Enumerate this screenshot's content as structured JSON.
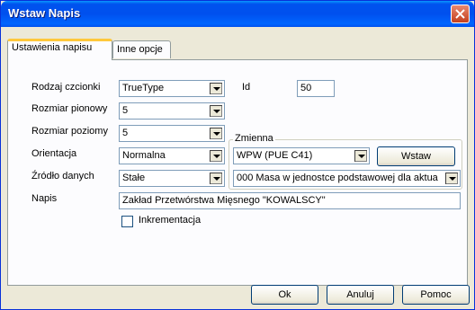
{
  "window": {
    "title": "Wstaw Napis"
  },
  "tabs": [
    {
      "label": "Ustawienia napisu",
      "active": true
    },
    {
      "label": "Inne opcje",
      "active": false
    }
  ],
  "fields": {
    "font_type": {
      "label": "Rodzaj czcionki",
      "value": "TrueType"
    },
    "id": {
      "label": "Id",
      "value": "50"
    },
    "vertical_size": {
      "label": "Rozmiar pionowy",
      "value": "5"
    },
    "horizontal_size": {
      "label": "Rozmiar poziomy",
      "value": "5"
    },
    "orientation": {
      "label": "Orientacja",
      "value": "Normalna"
    },
    "data_source": {
      "label": "Źródło danych",
      "value": "Stałe"
    },
    "text": {
      "label": "Napis",
      "value": "Zakład Przetwórstwa Mięsnego \"KOWALSCY\""
    },
    "increment": {
      "label": "Inkrementacja",
      "checked": false
    }
  },
  "variable_group": {
    "legend": "Zmienna",
    "variable_select": "WPW (PUE C41)",
    "insert_button": "Wstaw",
    "description_select": "000 Masa w jednostce podstawowej dla aktua"
  },
  "buttons": {
    "ok": "Ok",
    "cancel": "Anuluj",
    "help": "Pomoc"
  },
  "colors": {
    "titlebar": "#0053ee",
    "accent_tab": "#ffc83c",
    "close": "#c4401e"
  }
}
